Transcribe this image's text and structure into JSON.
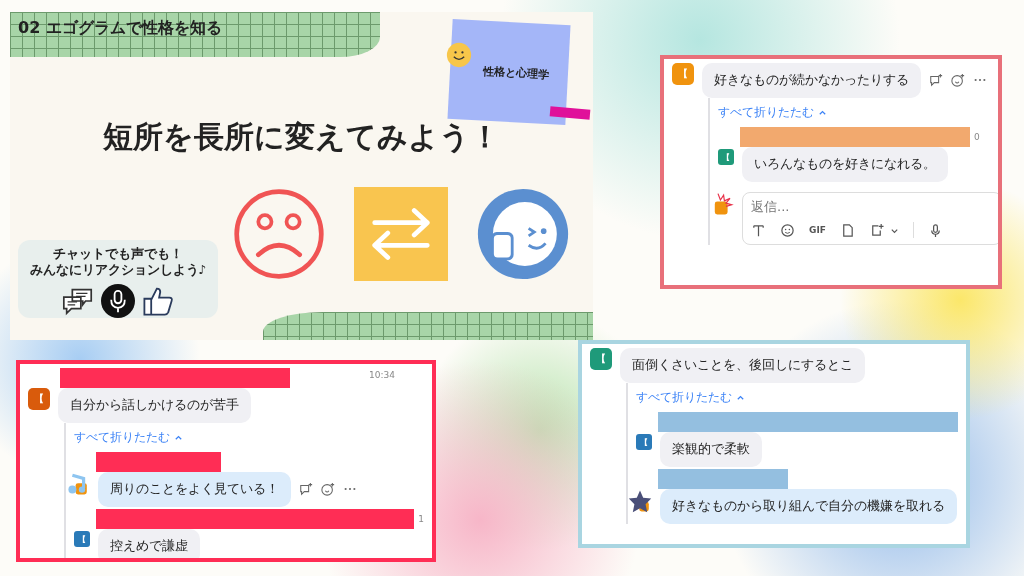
{
  "slide": {
    "section_title": "02 エゴグラムで性格を知る",
    "tag": "性格と心理学",
    "headline": "短所を長所に変えてみよう！",
    "reaction_box": {
      "lines": [
        "チャットでも声でも！",
        "みんなにリアクションしよう♪"
      ]
    }
  },
  "panels": [
    {
      "root": {
        "avatar": {
          "initial": "【",
          "color": "#f0930e"
        },
        "name_redacted": false,
        "text": "好きなものが続かなかったりする",
        "actions": true
      },
      "collapse_link": "すべて折りたたむ",
      "replies": [
        {
          "avatar": {
            "kind": "initial",
            "initial": "【",
            "color": "#1f9a7a"
          },
          "timestamp": "0",
          "text": "いろんなものを好きになれる。",
          "own": false,
          "actions": false
        }
      ],
      "compose": {
        "placeholder": "返信...",
        "gif_label": "GIF"
      }
    },
    {
      "root": {
        "avatar": {
          "initial": "【",
          "color": "#d95b0c"
        },
        "name_redacted": true,
        "timestamp": "10:34",
        "text": "自分から話しかけるのが苦手",
        "actions": false
      },
      "collapse_link": "すべて折りたたむ",
      "replies": [
        {
          "avatar": {
            "kind": "note"
          },
          "text": "周りのことをよく見ている！",
          "own": true,
          "actions": true
        },
        {
          "avatar": {
            "kind": "initial",
            "initial": "【",
            "color": "#2a7ab8"
          },
          "timestamp": "1",
          "text": "控えめで謙虚",
          "own": false,
          "actions": false
        }
      ]
    },
    {
      "root": {
        "avatar": {
          "initial": "【",
          "color": "#1f9a7a"
        },
        "name_redacted": false,
        "text": "面倒くさいことを、後回しにするとこ",
        "actions": false
      },
      "collapse_link": "すべて折りたたむ",
      "replies": [
        {
          "avatar": {
            "kind": "initial",
            "initial": "【",
            "color": "#2a7ab8"
          },
          "text": "楽観的で柔軟",
          "own": false,
          "actions": false
        },
        {
          "avatar": {
            "kind": "star"
          },
          "text": "好きなものから取り組んで自分の機嫌を取れる",
          "own": true,
          "actions": false
        }
      ]
    }
  ]
}
